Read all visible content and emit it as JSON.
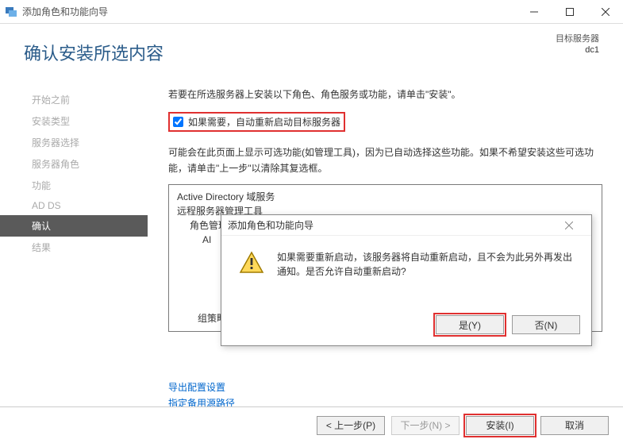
{
  "titlebar": {
    "title": "添加角色和功能向导"
  },
  "header": {
    "heading": "确认安装所选内容",
    "dest_label": "目标服务器",
    "dest_value": "dc1"
  },
  "sidebar": {
    "items": [
      {
        "label": "开始之前",
        "state": "dim"
      },
      {
        "label": "安装类型",
        "state": "dim"
      },
      {
        "label": "服务器选择",
        "state": "dim"
      },
      {
        "label": "服务器角色",
        "state": "dim"
      },
      {
        "label": "功能",
        "state": "dim"
      },
      {
        "label": "AD DS",
        "state": "dim"
      },
      {
        "label": "确认",
        "state": "selected"
      },
      {
        "label": "结果",
        "state": "dim"
      }
    ]
  },
  "content": {
    "intro": "若要在所选服务器上安装以下角色、角色服务或功能，请单击\"安装\"。",
    "checkbox_label": "如果需要，自动重新启动目标服务器",
    "note": "可能会在此页面上显示可选功能(如管理工具)，因为已自动选择这些功能。如果不希望安装这些可选功能，请单击\"上一步\"以清除其复选框。",
    "list": [
      {
        "text": "Active Directory 域服务",
        "indent": 0
      },
      {
        "text": "远程服务器管理工具",
        "indent": 0
      },
      {
        "text": "角色管理工具",
        "indent": 1
      },
      {
        "text": "AI",
        "indent": 2
      }
    ],
    "group_line": "组策略管理",
    "links": {
      "export": "导出配置设置",
      "alt_source": "指定备用源路径"
    }
  },
  "footer": {
    "prev": "< 上一步(P)",
    "next": "下一步(N) >",
    "install": "安装(I)",
    "cancel": "取消"
  },
  "modal": {
    "title": "添加角色和功能向导",
    "message": "如果需要重新启动，该服务器将自动重新启动，且不会为此另外再发出通知。是否允许自动重新启动?",
    "yes": "是(Y)",
    "no": "否(N)"
  }
}
